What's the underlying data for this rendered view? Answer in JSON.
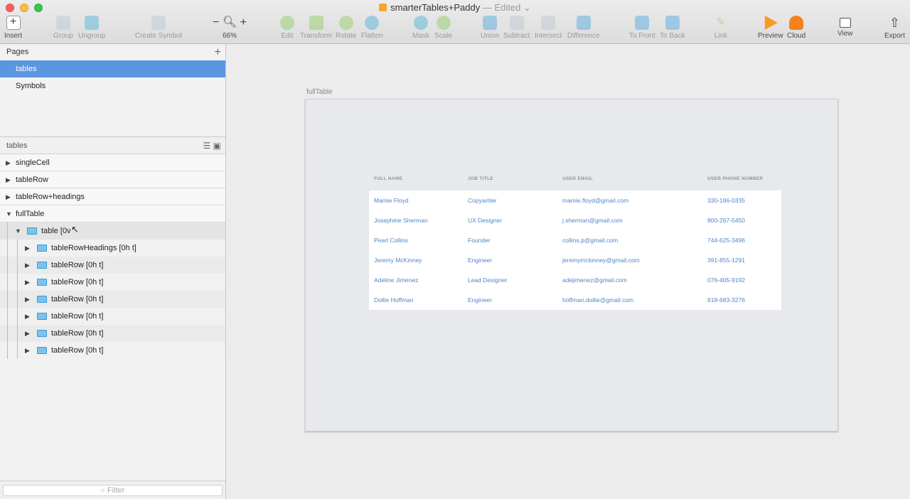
{
  "window": {
    "title": "smarterTables+Paddy",
    "status": "— Edited",
    "chevron": "⌄"
  },
  "toolbar": {
    "insert": "Insert",
    "group": "Group",
    "ungroup": "Ungroup",
    "create_symbol": "Create Symbol",
    "zoom_minus": "−",
    "zoom_plus": "+",
    "zoom_level": "66%",
    "edit": "Edit",
    "transform": "Transform",
    "rotate": "Rotate",
    "flatten": "Flatten",
    "mask": "Mask",
    "scale": "Scale",
    "union": "Union",
    "subtract": "Subtract",
    "intersect": "Intersect",
    "difference": "Difference",
    "to_front": "To Front",
    "to_back": "To Back",
    "link": "Link",
    "preview": "Preview",
    "cloud": "Cloud",
    "view": "View",
    "export": "Export"
  },
  "sidebar": {
    "pages_title": "Pages",
    "add_icon": "+",
    "pages": [
      {
        "label": "tables"
      },
      {
        "label": "Symbols"
      }
    ],
    "layers_title": "tables",
    "layers": [
      {
        "label": "singleCell",
        "arrow": "▶"
      },
      {
        "label": "tableRow",
        "arrow": "▶"
      },
      {
        "label": "tableRow+headings",
        "arrow": "▶"
      },
      {
        "label": "fullTable",
        "arrow": "▼"
      }
    ],
    "group_layer": {
      "label": "table [0v",
      "arrow": "▼"
    },
    "children": [
      {
        "label": "tableRowHeadings [0h t]",
        "arrow": "▶"
      },
      {
        "label": "tableRow [0h t]",
        "arrow": "▶"
      },
      {
        "label": "tableRow [0h t]",
        "arrow": "▶"
      },
      {
        "label": "tableRow [0h t]",
        "arrow": "▶"
      },
      {
        "label": "tableRow [0h t]",
        "arrow": "▶"
      },
      {
        "label": "tableRow [0h t]",
        "arrow": "▶"
      },
      {
        "label": "tableRow [0h t]",
        "arrow": "▶"
      }
    ],
    "filter_placeholder": "Filter"
  },
  "canvas": {
    "artboard_name": "fullTable",
    "headers": [
      "FULL NAME",
      "JOB TITLE",
      "USER EMAIL",
      "USER PHONE NUMBER"
    ],
    "rows": [
      [
        "Mamie Floyd",
        "Copywriter",
        "mamie.floyd@gmail.com",
        "330-186-0335"
      ],
      [
        "Josephine Sherman",
        "UX Designer",
        "j.sherman@gmail.com",
        "800-267-5450"
      ],
      [
        "Pearl Collins",
        "Founder",
        "collins.p@gmail.com",
        "744-625-3496"
      ],
      [
        "Jeremy McKinney",
        "Engineer",
        "jeremymckinney@gmail.com",
        "391-855-1291"
      ],
      [
        "Adeline Jimenez",
        "Lead Designer",
        "adejimenez@gmail.com",
        "076-405-9192"
      ],
      [
        "Dollie Hoffman",
        "Engineer",
        "hoffman.dollie@gmail.com",
        "618-683-3276"
      ]
    ]
  },
  "colors": {
    "selection": "#5b96e0",
    "link_text": "#4f86c6",
    "header_text": "#8a93a0"
  }
}
